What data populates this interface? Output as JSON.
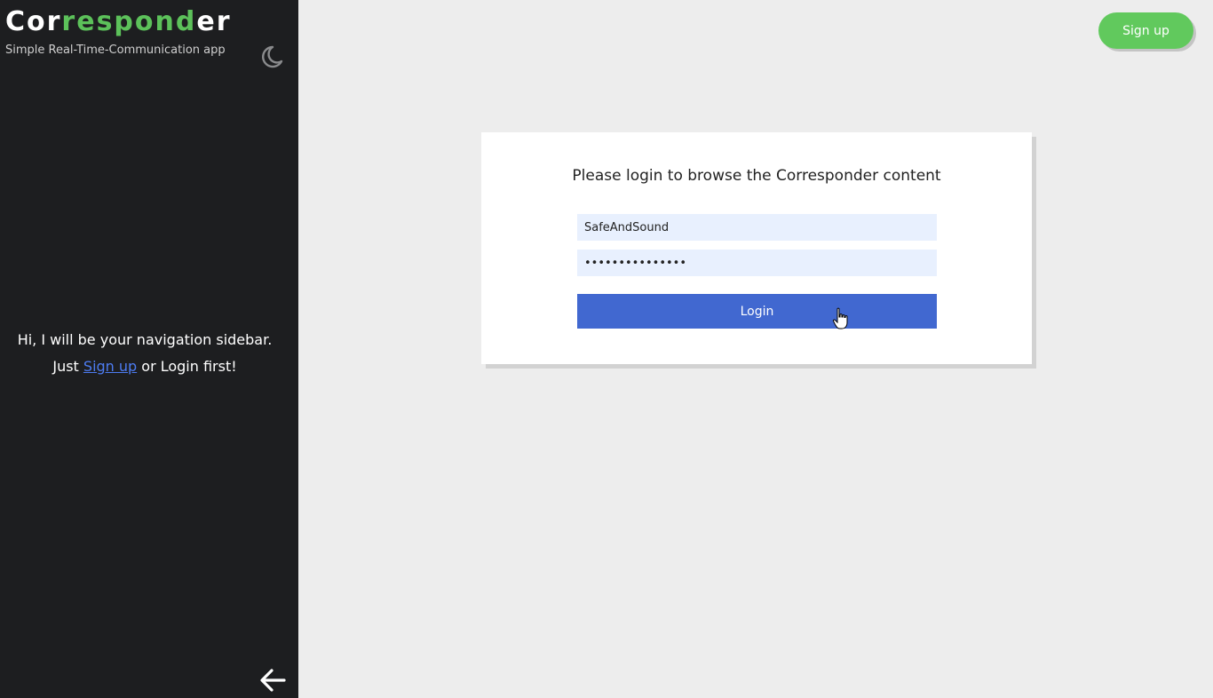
{
  "app": {
    "logo_parts": [
      "Cor",
      "respond",
      "er"
    ],
    "tagline": "Simple Real-Time-Communication app"
  },
  "sidebar": {
    "message_line1": "Hi, I will be your navigation sidebar.",
    "message_prefix": "Just ",
    "signup_link": "Sign up",
    "message_suffix": " or Login first!",
    "theme_icon": "moon-icon",
    "collapse_icon": "arrow-left-icon"
  },
  "header": {
    "signup_label": "Sign up"
  },
  "login": {
    "heading": "Please login to browse the Corresponder content",
    "username_value": "SafeAndSound",
    "password_value": "•••••••••••••••",
    "button_label": "Login"
  },
  "colors": {
    "brand_green": "#5cc15a",
    "login_button": "#4168d0",
    "signup_button": "#61c95d",
    "sidebar_bg": "#1d1e20",
    "input_bg": "#e8f0fe"
  }
}
